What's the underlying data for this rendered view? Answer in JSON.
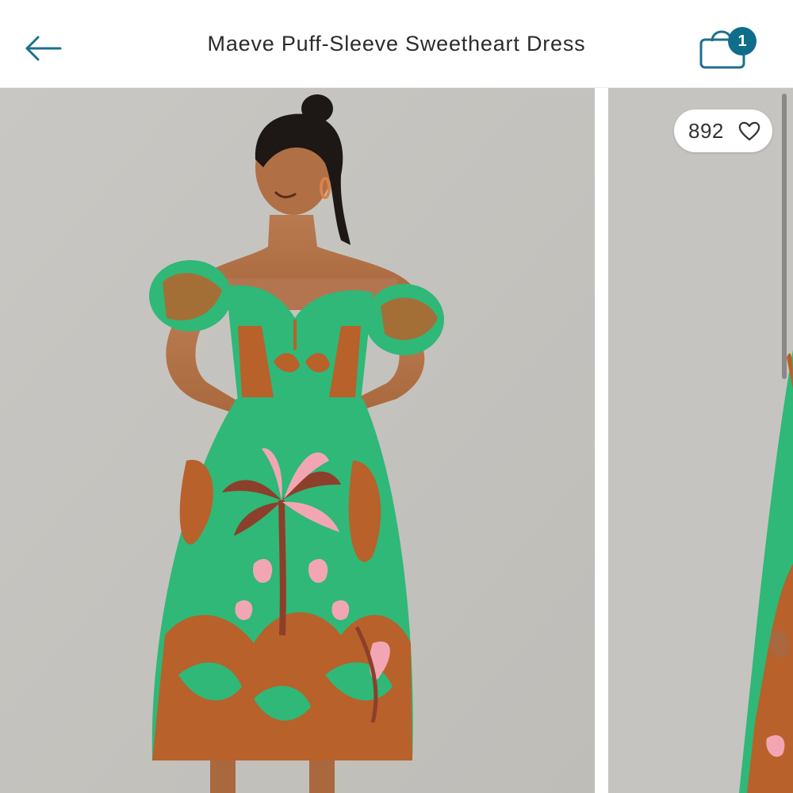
{
  "header": {
    "title": "Maeve Puff-Sleeve Sweetheart Dress",
    "back_icon": "arrow-left-icon",
    "bag_icon": "shopping-bag-icon",
    "bag_count": "1"
  },
  "gallery": {
    "slides": [
      "product-photo-front",
      "product-photo-side"
    ],
    "likes": "892",
    "like_icon": "heart-outline-icon"
  },
  "colors": {
    "accent": "#1e6f8e",
    "badge": "#0f6d8c",
    "photo_background": "#c7c5c1",
    "dress_green": "#2fb878",
    "dress_rust": "#b8612b",
    "dress_pink": "#f2a6b4",
    "skin": "#b5754c",
    "hair": "#1d1715"
  }
}
